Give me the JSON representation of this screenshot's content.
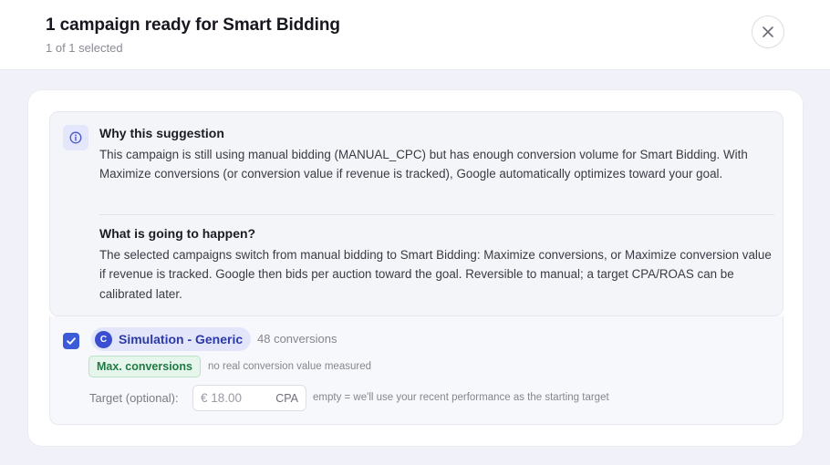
{
  "header": {
    "title": "1 campaign ready for Smart Bidding",
    "subtitle": "1 of 1 selected",
    "close_icon": "close-icon"
  },
  "suggestion": {
    "icon": "info-icon",
    "why_title": "Why this suggestion",
    "why_body": "This campaign is still using manual bidding (MANUAL_CPC) but has enough conversion volume for Smart Bidding. With Maximize conversions (or conversion value if revenue is tracked), Google automatically optimizes toward your goal.",
    "what_title": "What is going to happen?",
    "what_body": "The selected campaigns switch from manual bidding to Smart Bidding: Maximize conversions, or Maximize conversion value if revenue is tracked. Google then bids per auction toward the goal. Reversible to manual; a target CPA/ROAS can be calibrated later."
  },
  "campaign": {
    "checked": true,
    "initial": "C",
    "name": "Simulation - Generic",
    "conversions": "48 conversions",
    "strategy": "Max. conversions",
    "strategy_note": "no real conversion value measured",
    "target_label": "Target (optional):",
    "target_placeholder": "€ 18.00",
    "target_unit": "CPA",
    "target_hint": "empty = we'll use your recent performance as the starting target"
  },
  "colors": {
    "accent": "#3b5bd9",
    "chip_bg": "#e3e6fb",
    "badge_green": "#1f7a43",
    "page_bg": "#f1f1fa"
  }
}
